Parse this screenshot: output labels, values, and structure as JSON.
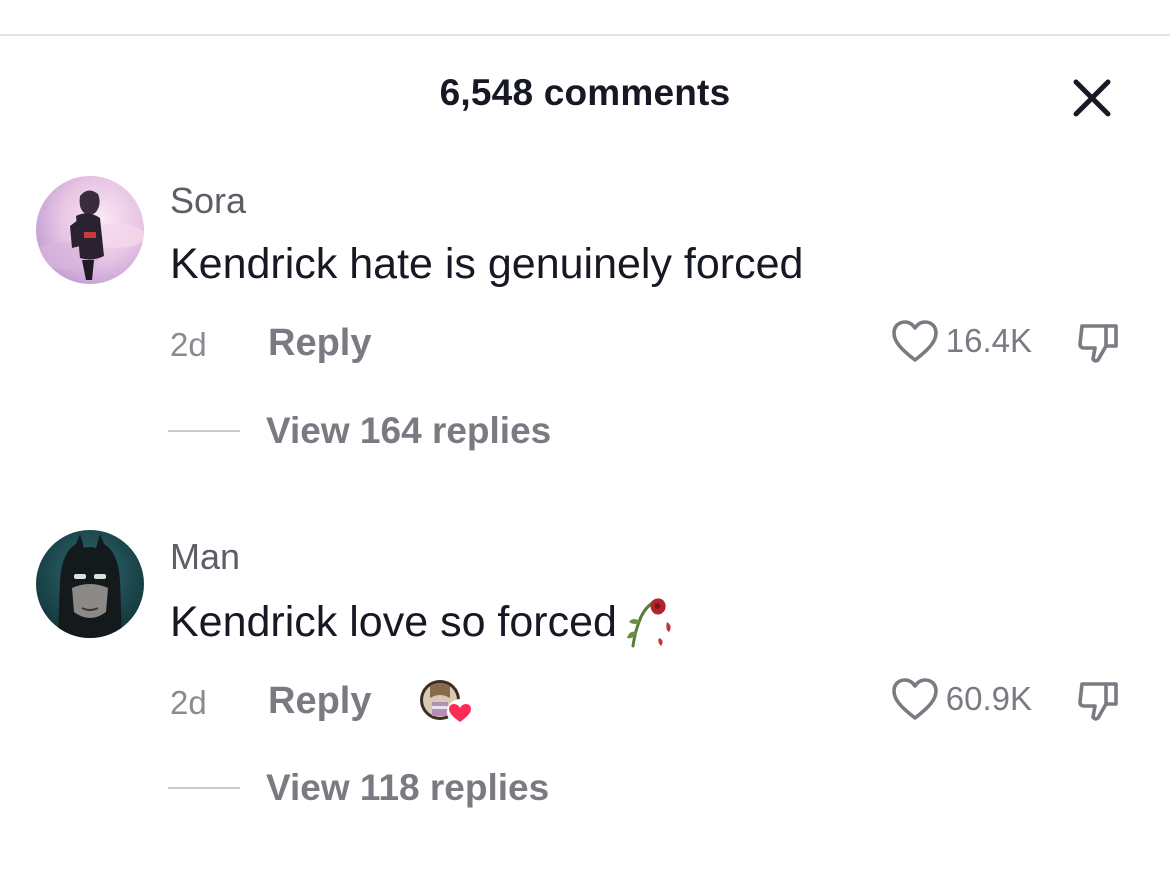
{
  "header": {
    "title": "6,548 comments"
  },
  "comments": [
    {
      "username": "Sora",
      "text": "Kendrick hate is genuinely forced",
      "time": "2d",
      "reply_label": "Reply",
      "likes": "16.4K",
      "view_replies": "View 164 replies",
      "creator_liked": false
    },
    {
      "username": "Man",
      "text": "Kendrick love so forced",
      "emoji": "wilted-rose",
      "time": "2d",
      "reply_label": "Reply",
      "likes": "60.9K",
      "view_replies": "View 118 replies",
      "creator_liked": true
    }
  ],
  "icons": {
    "close": "close-icon",
    "like": "heart-outline-icon",
    "dislike": "thumbs-down-icon",
    "creator_like_badge": "heart-filled-icon"
  },
  "colors": {
    "text_primary": "#161823",
    "text_secondary": "#7a7b82",
    "creator_heart": "#fe2c55"
  }
}
